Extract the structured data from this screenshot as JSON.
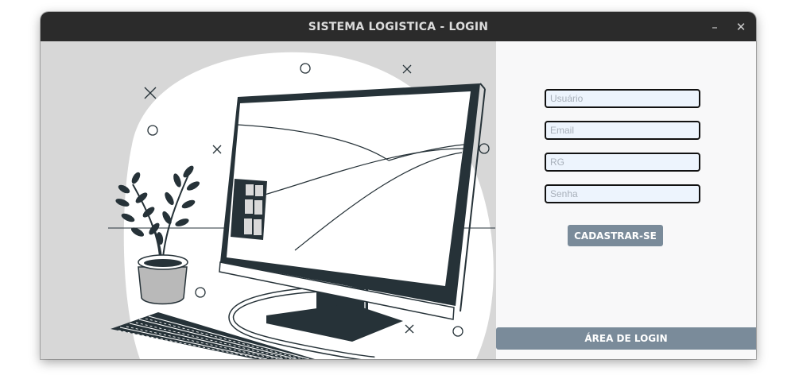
{
  "window": {
    "title": "SISTEMA LOGISTICA - LOGIN",
    "minimize_glyph": "–",
    "close_glyph": "✕"
  },
  "form": {
    "username_placeholder": "Usuário",
    "email_placeholder": "Email",
    "rg_placeholder": "RG",
    "password_placeholder": "Senha",
    "register_label": "CADASTRAR-SE",
    "login_area_label": "ÁREA DE LOGIN"
  },
  "colors": {
    "titlebar": "#2b2b2b",
    "illustration_bg": "#d7d7d7",
    "field_bg": "#edf4fd",
    "button": "#7a8b9a",
    "dark_ink": "#263238"
  },
  "illustration": {
    "subject": "desktop-computer-with-keyboard-and-plant",
    "icons": [
      "circle-icon",
      "x-mark-icon"
    ]
  }
}
